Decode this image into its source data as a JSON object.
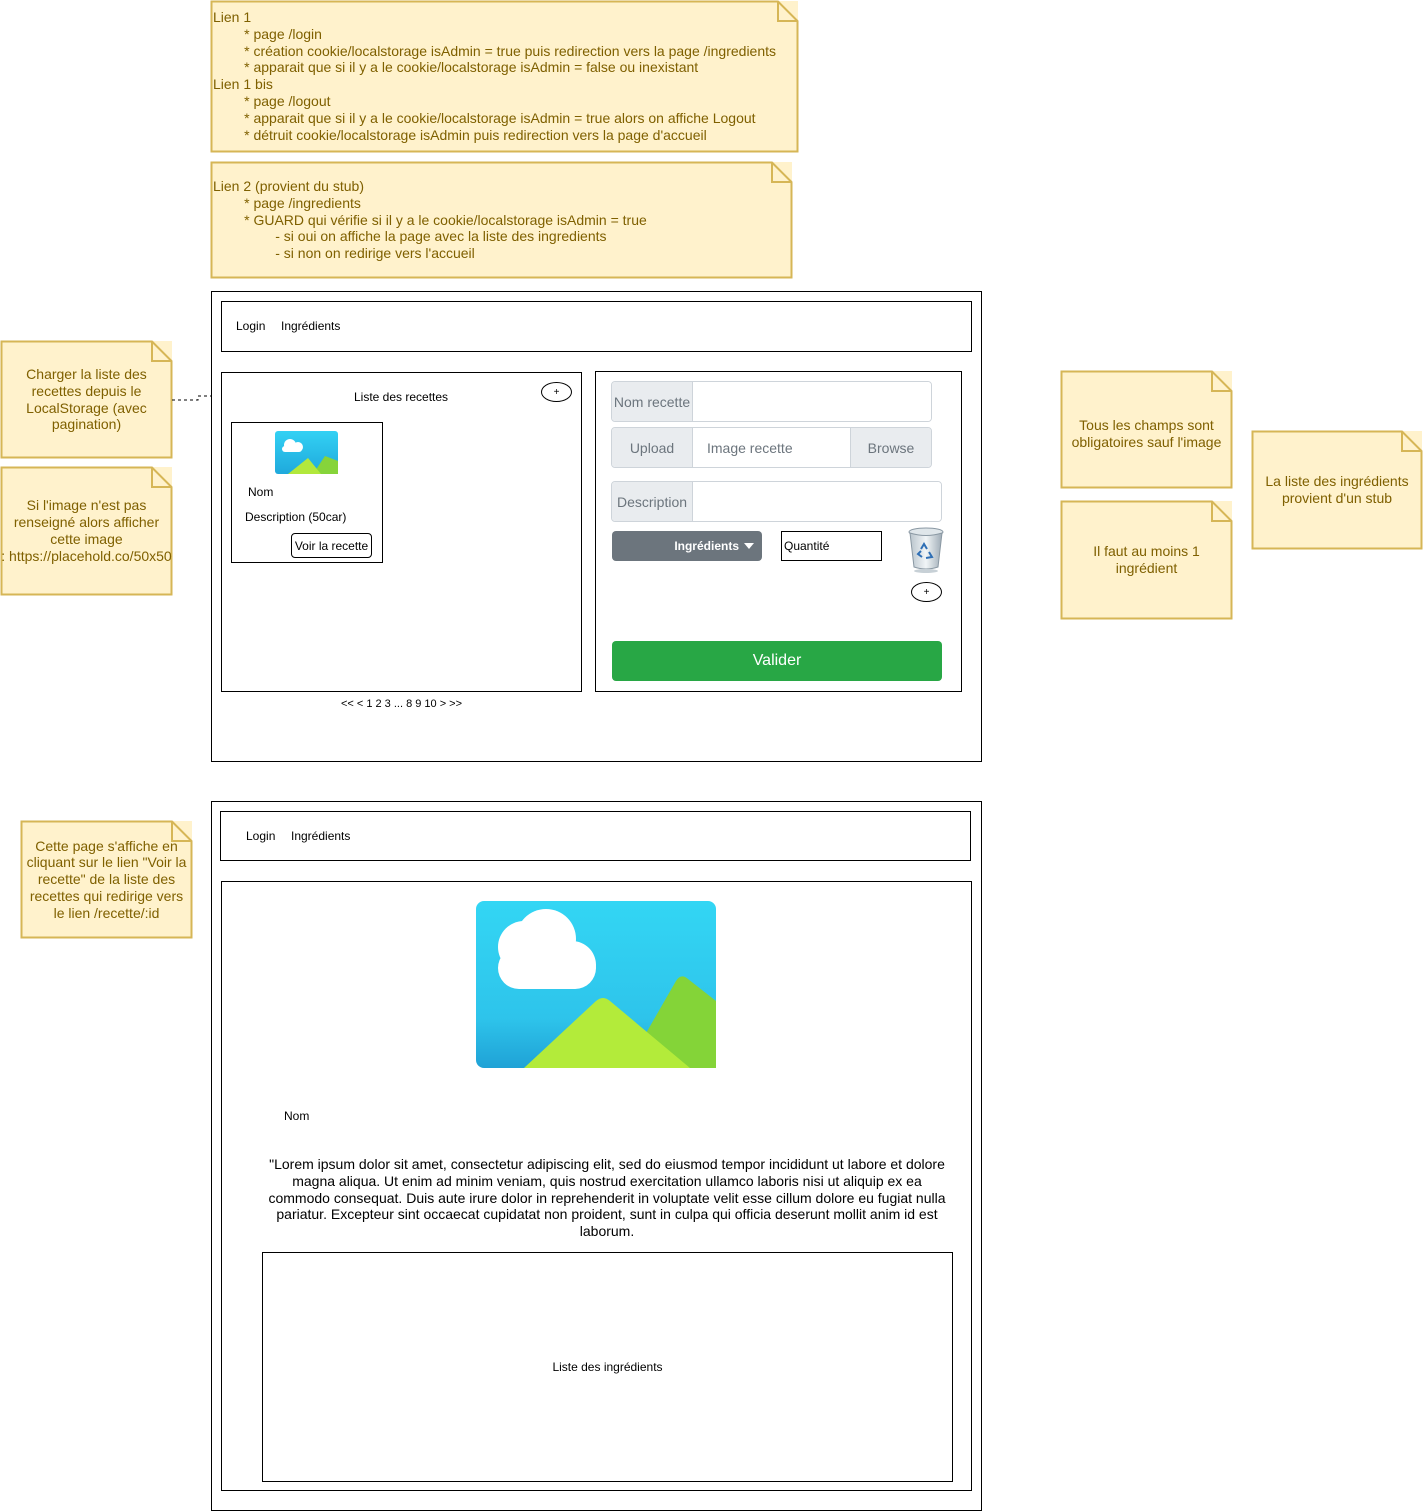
{
  "notes": {
    "lien1": "Lien 1\n        * page /login\n        * création cookie/localstorage isAdmin = true puis redirection vers la page /ingredients\n        * apparait que si il y a le cookie/localstorage isAdmin = false ou inexistant\nLien 1 bis\n        * page /logout\n        * apparait que si il y a le cookie/localstorage isAdmin = true alors on affiche Logout\n        * détruit cookie/localstorage isAdmin puis redirection vers la page d'accueil",
    "lien2": "Lien 2 (provient du stub)\n        * page /ingredients\n        * GUARD qui vérifie si il y a le cookie/localstorage isAdmin = true\n                - si oui on affiche la page avec la liste des ingredients\n                - si non on redirige vers l'accueil",
    "charger": "Charger la liste des\nrecettes depuis le\nLocalStorage (avec\npagination)",
    "image": "Si l'image n'est pas\nrenseigné alors afficher\ncette image\n: https://placehold.co/50x50",
    "champs": "Tous les champs sont\nobligatoires sauf l'image",
    "ingredient": "Il faut au moins 1\ningrédient",
    "stub": "La liste des ingrédients\nprovient d'un stub",
    "detail": "Cette page s'affiche en\ncliquant sur le lien \"Voir la\nrecette\" de la liste des\nrecettes qui redirige vers\nle lien /recette/:id"
  },
  "nav": {
    "login": "Login",
    "ingredients": "Ingrédients"
  },
  "list_panel": {
    "title": "Liste des recettes",
    "add": "+",
    "card": {
      "name": "Nom",
      "description": "Description (50car)",
      "button": "Voir la recette"
    },
    "pagination": "<< < 1 2 3 ... 8 9 10 > >>"
  },
  "form": {
    "name_label": "Nom recette",
    "upload_label": "Upload",
    "image_placeholder": "Image recette",
    "browse_label": "Browse",
    "description_label": "Description",
    "ingredients_dropdown": "Ingrédients",
    "quantity_placeholder": "Quantité",
    "add": "+",
    "submit": "Valider"
  },
  "detail_page": {
    "name": "Nom",
    "lorem": "\"Lorem ipsum dolor sit amet, consectetur adipiscing elit, sed do eiusmod tempor incididunt ut labore et dolore magna aliqua. Ut enim ad minim veniam, quis nostrud exercitation ullamco laboris nisi ut aliquip ex ea commodo consequat. Duis aute irure dolor in reprehenderit in voluptate velit esse cillum dolore eu fugiat nulla pariatur. Excepteur sint occaecat cupidatat non proident, sunt in culpa qui officia deserunt mollit anim id est laborum.",
    "ingredients_list": "Liste des ingrédients"
  },
  "icons": {
    "image_placeholder": "image-placeholder-icon",
    "trash": "recycle-bin-icon",
    "dropdown": "caret-down-icon"
  },
  "colors": {
    "note_fill": "#fff2cc",
    "note_border": "#d6b656",
    "note_text": "#7f6000",
    "submit_green": "#28a745",
    "dropdown_gray": "#6c757d"
  }
}
